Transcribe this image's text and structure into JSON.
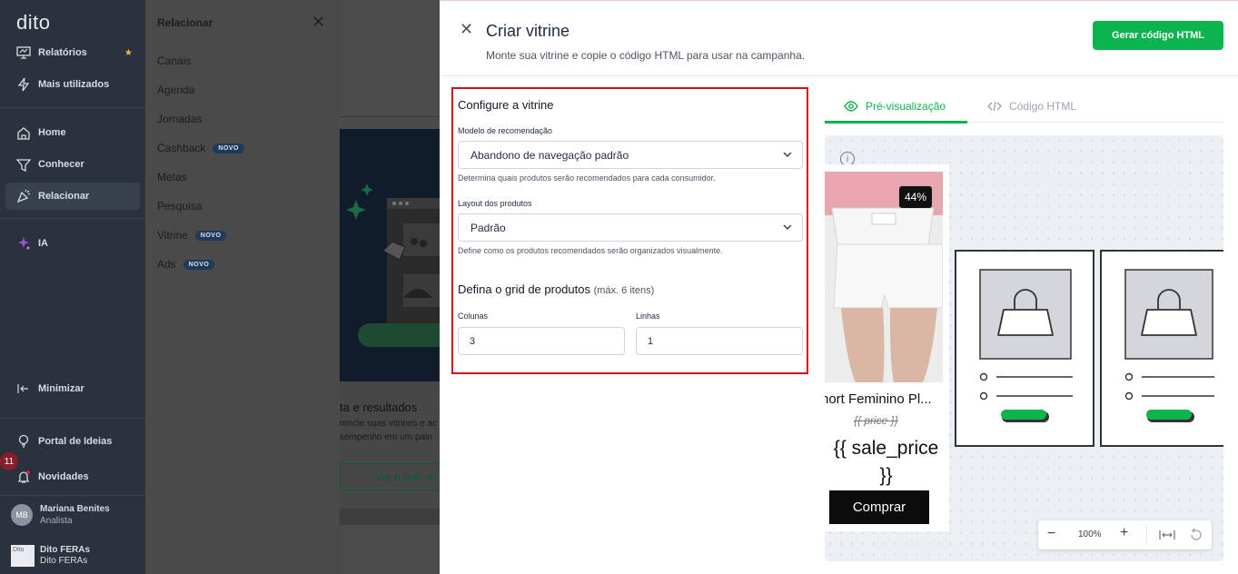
{
  "sidebar": {
    "logo": "dito",
    "items": [
      {
        "label": "Relatórios",
        "icon": "report-icon"
      },
      {
        "label": "Mais utilizados",
        "icon": "bolt-icon"
      },
      {
        "label": "Home",
        "icon": "home-icon"
      },
      {
        "label": "Conhecer",
        "icon": "filter-icon"
      },
      {
        "label": "Relacionar",
        "icon": "megaphone-icon"
      },
      {
        "label": "IA",
        "icon": "sparkle-icon"
      }
    ],
    "minimize": "Minimizar",
    "portal": "Portal de Ideias",
    "novidades": "Novidades",
    "notif_count": "11",
    "user": {
      "initials": "MB",
      "name": "Mariana Benites",
      "role": "Analista"
    },
    "org": {
      "logo_alt": "Dito",
      "name": "Dito FERAs",
      "sub": "Dito FERAs"
    }
  },
  "submenu": {
    "title": "Relacionar",
    "items": [
      {
        "label": "Canais",
        "badge": ""
      },
      {
        "label": "Agenda",
        "badge": ""
      },
      {
        "label": "Jornadas",
        "badge": ""
      },
      {
        "label": "Cashback",
        "badge": "NOVO"
      },
      {
        "label": "Metas",
        "badge": ""
      },
      {
        "label": "Pesquisa",
        "badge": ""
      },
      {
        "label": "Vitrine",
        "badge": "NOVO"
      },
      {
        "label": "Ads",
        "badge": "NOVO"
      }
    ]
  },
  "background": {
    "heading": "ta e resultados",
    "line1": "rencie suas vitrines e ac",
    "line2": "sempenho em um pain",
    "button": "Ver o que ve"
  },
  "modal": {
    "title": "Criar vitrine",
    "subtitle": "Monte sua vitrine e copie o código HTML para usar na campanha.",
    "generate_button": "Gerar código HTML",
    "config": {
      "title": "Configure a vitrine",
      "model_label": "Modelo de recomendação",
      "model_value": "Abandono de navegação padrão",
      "model_hint": "Determina quais produtos serão recomendados para cada consumidor.",
      "layout_label": "Layout dos produtos",
      "layout_value": "Padrão",
      "layout_hint": "Define como os produtos recomendados serão organizados visualmente.",
      "grid_title": "Defina o grid de produtos",
      "grid_note": "(máx. 6 itens)",
      "columns_label": "Colunas",
      "columns_value": "3",
      "rows_label": "Linhas",
      "rows_value": "1"
    },
    "tabs": {
      "preview": "Pré-visualização",
      "code": "Código HTML"
    },
    "preview": {
      "discount": "44%",
      "product_name": "hort Feminino Pl...",
      "price": "{{ price }}",
      "sale_price": "{{ sale_price }}",
      "buy_button": "Comprar",
      "zoom": "100%"
    }
  },
  "colors": {
    "accent": "#0bb44e",
    "highlight_border": "#d90d1c",
    "sidebar_bg": "#2b313d"
  }
}
